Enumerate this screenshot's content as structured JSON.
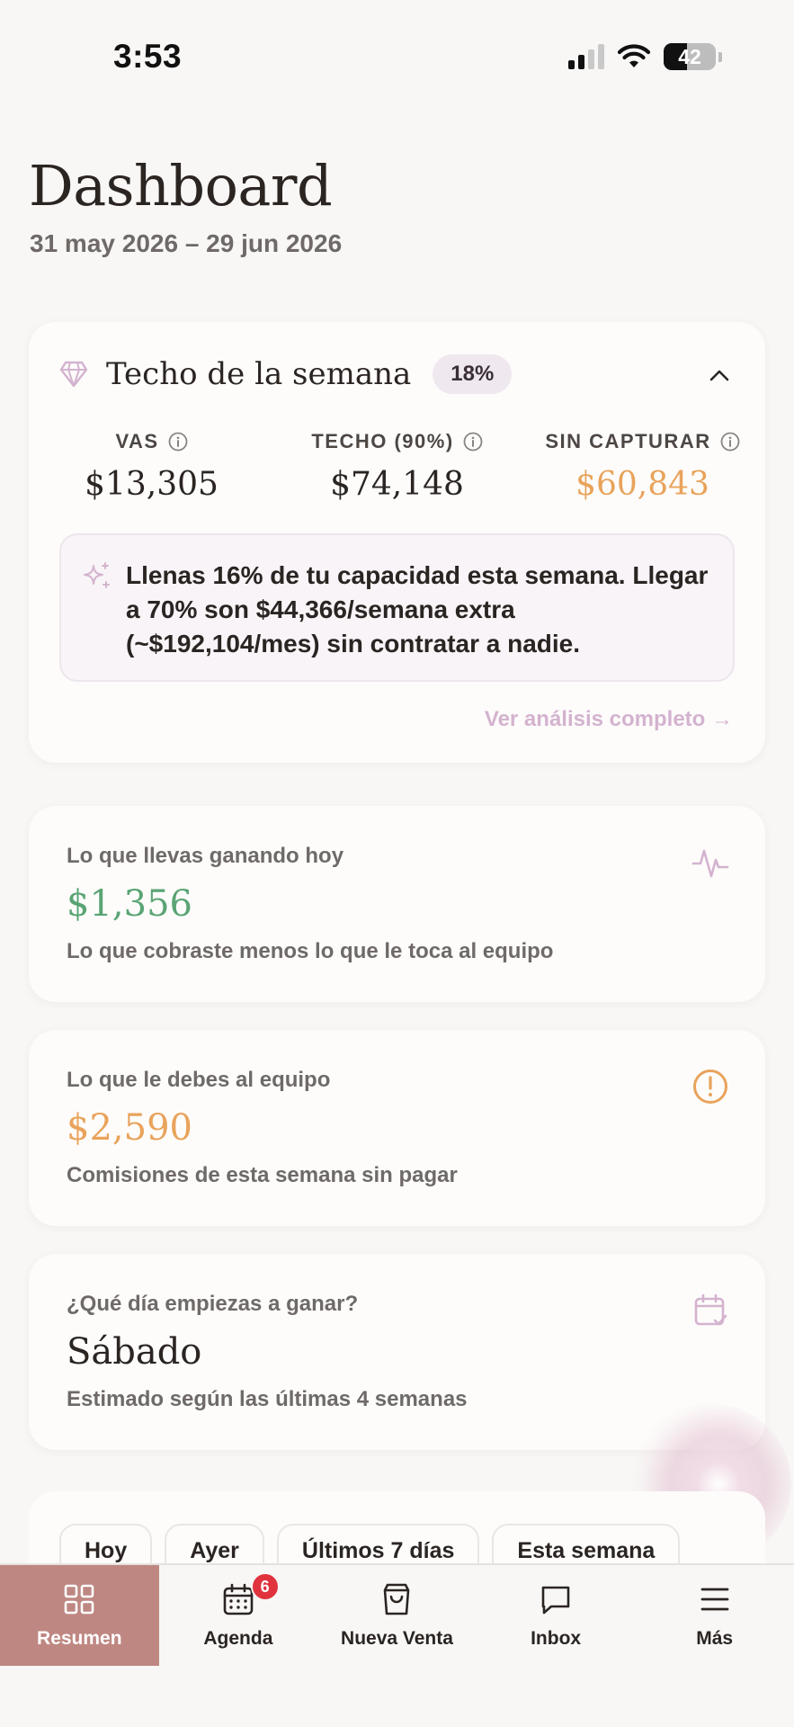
{
  "status_bar": {
    "time": "3:53",
    "battery": "42"
  },
  "header": {
    "title": "Dashboard",
    "date_range": "31 may 2026 – 29 jun 2026"
  },
  "techo": {
    "title": "Techo de la semana",
    "badge": "18%",
    "metrics": [
      {
        "label": "VAS",
        "value": "$13,305"
      },
      {
        "label": "TECHO (90%)",
        "value": "$74,148"
      },
      {
        "label": "SIN CAPTURAR",
        "value": "$60,843"
      }
    ],
    "insight": "Llenas 16% de tu capacidad esta semana. Llegar a 70% son $44,366/semana extra (~$192,104/mes) sin contratar a nadie.",
    "link": "Ver análisis completo →"
  },
  "cards": [
    {
      "label": "Lo que llevas ganando hoy",
      "value": "$1,356",
      "sub": "Lo que cobraste menos lo que le toca al equipo",
      "value_color": "#5aa474",
      "icon": "activity-icon"
    },
    {
      "label": "Lo que le debes al equipo",
      "value": "$2,590",
      "sub": "Comisiones de esta semana sin pagar",
      "value_color": "#e9a35b",
      "icon": "alert-circle-icon"
    },
    {
      "label": "¿Qué día empiezas a ganar?",
      "value": "Sábado",
      "sub": "Estimado según las últimas 4 semanas",
      "value_color": "#2b2522",
      "icon": "calendar-check-icon"
    }
  ],
  "filters": [
    "Hoy",
    "Ayer",
    "Últimos 7 días",
    "Esta semana"
  ],
  "tabs": [
    {
      "label": "Resumen",
      "icon": "grid-icon",
      "active": true
    },
    {
      "label": "Agenda",
      "icon": "calendar-icon",
      "badge": "6"
    },
    {
      "label": "Nueva Venta",
      "icon": "shopping-bag-icon"
    },
    {
      "label": "Inbox",
      "icon": "message-icon"
    },
    {
      "label": "Más",
      "icon": "menu-icon"
    }
  ],
  "colors": {
    "accent": "#bf8782",
    "lavender": "#d4b3cf",
    "warning": "#e9a35b",
    "success": "#5aa474",
    "badge": "#e0333e"
  }
}
